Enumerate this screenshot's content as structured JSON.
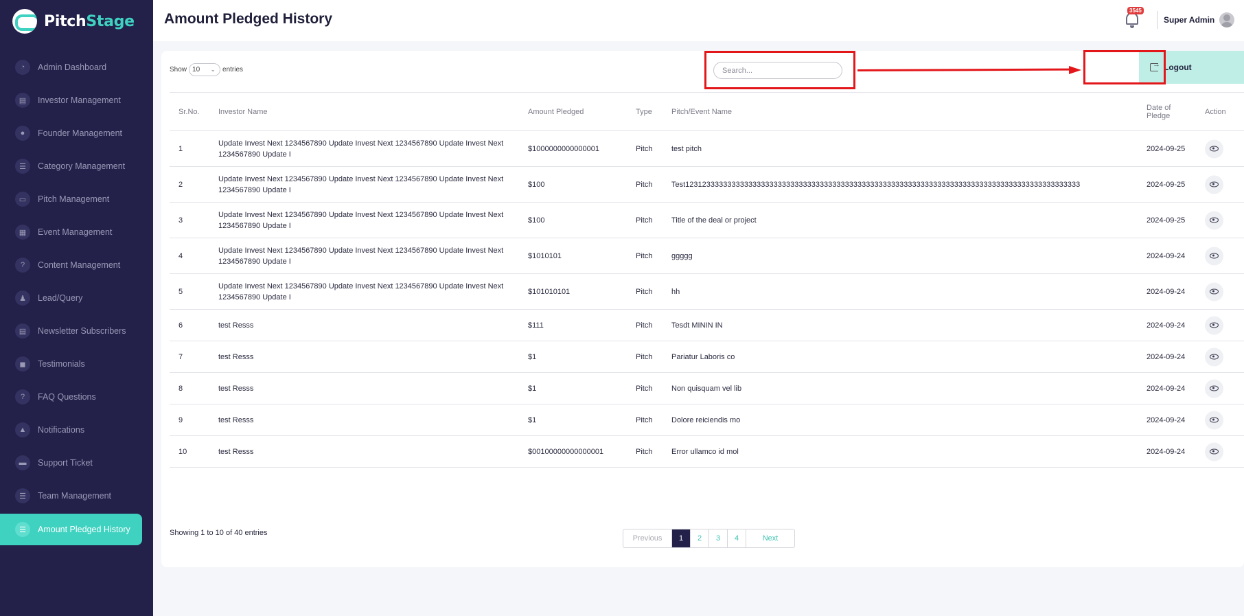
{
  "brand": {
    "name_main": "Pitch",
    "name_accent": "Stage"
  },
  "sidebar": {
    "items": [
      {
        "label": "Admin Dashboard",
        "icon": "dashboard-icon",
        "glyph": "◔"
      },
      {
        "label": "Investor Management",
        "icon": "investor-icon",
        "glyph": "▤"
      },
      {
        "label": "Founder Management",
        "icon": "bulb-icon",
        "glyph": "●"
      },
      {
        "label": "Category Management",
        "icon": "list-icon",
        "glyph": "☰"
      },
      {
        "label": "Pitch Management",
        "icon": "presentation-icon",
        "glyph": "▭"
      },
      {
        "label": "Event Management",
        "icon": "calendar-icon",
        "glyph": "▦"
      },
      {
        "label": "Content Management",
        "icon": "question-icon",
        "glyph": "?"
      },
      {
        "label": "Lead/Query",
        "icon": "users-icon",
        "glyph": "♟"
      },
      {
        "label": "Newsletter Subscribers",
        "icon": "newspaper-icon",
        "glyph": "▤"
      },
      {
        "label": "Testimonials",
        "icon": "chat-icon",
        "glyph": "◼"
      },
      {
        "label": "FAQ Questions",
        "icon": "question-icon",
        "glyph": "?"
      },
      {
        "label": "Notifications",
        "icon": "bell-icon",
        "glyph": "▲"
      },
      {
        "label": "Support Ticket",
        "icon": "ticket-icon",
        "glyph": "▬"
      },
      {
        "label": "Team Management",
        "icon": "list-icon",
        "glyph": "☰"
      },
      {
        "label": "Amount Pledged History",
        "icon": "list-icon",
        "glyph": "☰",
        "active": true
      }
    ]
  },
  "header": {
    "title": "Amount Pledged History",
    "notification_count": "3545",
    "admin_name": "Super Admin"
  },
  "controls": {
    "show_label": "Show",
    "entries_value": "10",
    "entries_label": "entries",
    "search_placeholder": "Search...",
    "logout_label": "Logout"
  },
  "table": {
    "headers": {
      "sr": "Sr.No.",
      "investor": "Investor Name",
      "amount": "Amount Pledged",
      "type": "Type",
      "pitch": "Pitch/Event Name",
      "date": "Date of Pledge",
      "action": "Action"
    },
    "rows": [
      {
        "sr": "1",
        "investor": "Update Invest Next 1234567890 Update Invest Next 1234567890 Update Invest Next 1234567890 Update I",
        "amount": "$1000000000000001",
        "type": "Pitch",
        "pitch": "test pitch",
        "date": "2024-09-25"
      },
      {
        "sr": "2",
        "investor": "Update Invest Next 1234567890 Update Invest Next 1234567890 Update Invest Next 1234567890 Update I",
        "amount": "$100",
        "type": "Pitch",
        "pitch": "Test1231233333333333333333333333333333333333333333333333333333333333333333333333333333333333333333",
        "date": "2024-09-25"
      },
      {
        "sr": "3",
        "investor": "Update Invest Next 1234567890 Update Invest Next 1234567890 Update Invest Next 1234567890 Update I",
        "amount": "$100",
        "type": "Pitch",
        "pitch": "Title of the deal or project",
        "date": "2024-09-25"
      },
      {
        "sr": "4",
        "investor": "Update Invest Next 1234567890 Update Invest Next 1234567890 Update Invest Next 1234567890 Update I",
        "amount": "$1010101",
        "type": "Pitch",
        "pitch": "ggggg",
        "date": "2024-09-24"
      },
      {
        "sr": "5",
        "investor": "Update Invest Next 1234567890 Update Invest Next 1234567890 Update Invest Next 1234567890 Update I",
        "amount": "$101010101",
        "type": "Pitch",
        "pitch": "hh",
        "date": "2024-09-24"
      },
      {
        "sr": "6",
        "investor": "test Resss",
        "amount": "$111",
        "type": "Pitch",
        "pitch": "Tesdt MININ IN",
        "date": "2024-09-24"
      },
      {
        "sr": "7",
        "investor": "test Resss",
        "amount": "$1",
        "type": "Pitch",
        "pitch": "Pariatur Laboris co",
        "date": "2024-09-24"
      },
      {
        "sr": "8",
        "investor": "test Resss",
        "amount": "$1",
        "type": "Pitch",
        "pitch": "Non quisquam vel lib",
        "date": "2024-09-24"
      },
      {
        "sr": "9",
        "investor": "test Resss",
        "amount": "$1",
        "type": "Pitch",
        "pitch": "Dolore reiciendis mo",
        "date": "2024-09-24"
      },
      {
        "sr": "10",
        "investor": "test Resss",
        "amount": "$00100000000000001",
        "type": "Pitch",
        "pitch": "Error ullamco id mol",
        "date": "2024-09-24"
      }
    ]
  },
  "footer": {
    "showing_text": "Showing 1 to 10 of 40 entries",
    "prev_label": "Previous",
    "next_label": "Next",
    "pages": [
      "1",
      "2",
      "3",
      "4"
    ],
    "current_page": "1"
  },
  "colors": {
    "sidebar_bg": "#23214a",
    "accent": "#3fd2c0",
    "highlight_red": "#e3161a",
    "logout_bg": "#bfeee6"
  }
}
